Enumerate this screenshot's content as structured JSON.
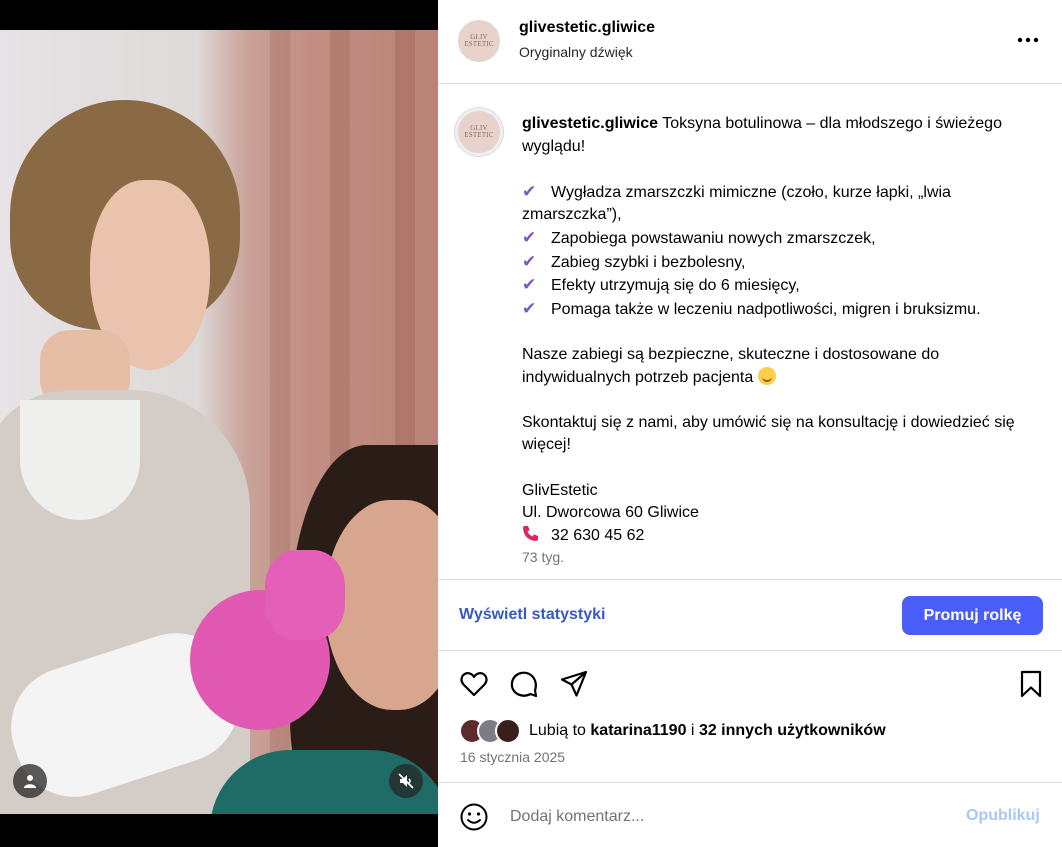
{
  "post": {
    "username": "glivestetic.gliwice",
    "audio": "Oryginalny dźwięk",
    "avatar_logo": [
      "GLIV",
      "ESTETIC"
    ]
  },
  "caption": {
    "username": "glivestetic.gliwice",
    "intro": "Toksyna botulinowa – dla młodszego i świeżego wyglądu!",
    "bullets": [
      "Wygładza zmarszczki mimiczne (czoło, kurze łapki, „lwia zmarszczka”),",
      "Zapobiega powstawaniu nowych zmarszczek,",
      "Zabieg szybki i bezbolesny,",
      "Efekty utrzymują się do 6 miesięcy,",
      "Pomaga także w leczeniu nadpotliwości, migren i bruksizmu."
    ],
    "paragraph1": "Nasze zabiegi są bezpieczne, skuteczne i dostosowane do indywidualnych potrzeb pacjenta",
    "paragraph2": "Skontaktuj się z nami, aby umówić się na konsultację i dowiedzieć się więcej!",
    "business_name": "GlivEstetic",
    "address": "Ul. Dworcowa 60 Gliwice",
    "phone": "32 630 45 62",
    "age": "73 tyg."
  },
  "stats": {
    "view_label": "Wyświetl statystyki",
    "promote_label": "Promuj rolkę"
  },
  "likes": {
    "prefix": "Lubią to",
    "user": "katarina1190",
    "connector": "i",
    "others": "32 innych użytkowników"
  },
  "date": "16 stycznia 2025",
  "comment": {
    "placeholder": "Dodaj komentarz...",
    "publish_label": "Opublikuj"
  },
  "colors": {
    "accent": "#4a5df9",
    "link": "#3759c7",
    "check": "#7e57c2",
    "publish_disabled": "#a9c6f5"
  },
  "icons": [
    "more-icon",
    "heart-icon",
    "comment-icon",
    "share-icon",
    "bookmark-icon",
    "emoji-icon",
    "user-icon",
    "muted-icon",
    "check-icon",
    "phone-icon"
  ]
}
